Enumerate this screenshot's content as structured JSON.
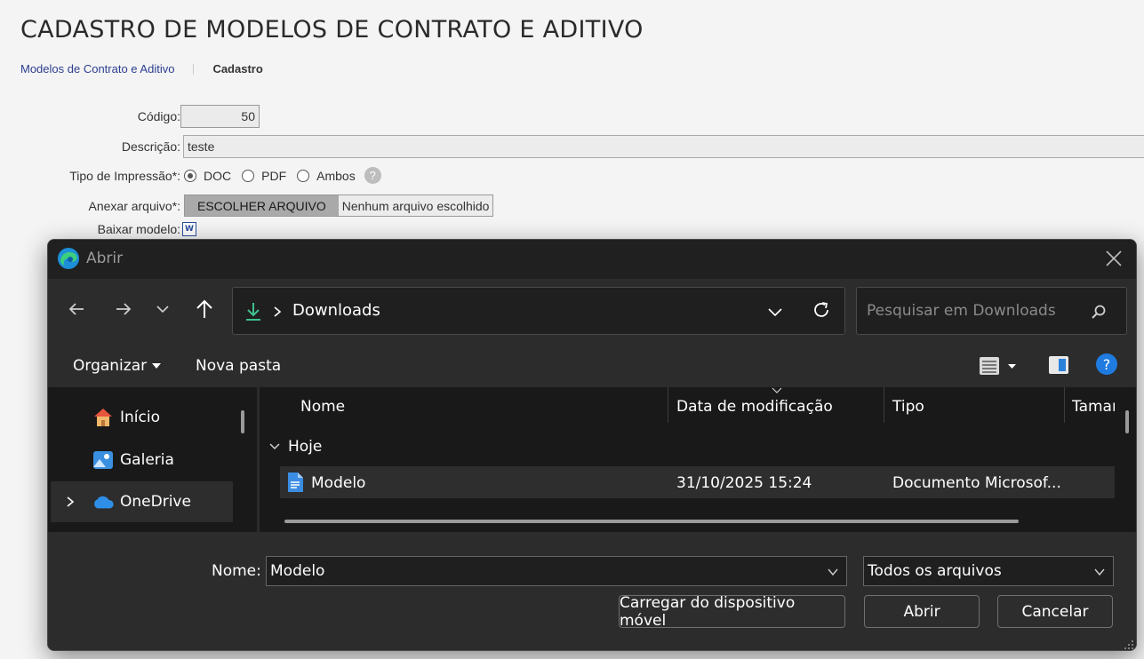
{
  "page": {
    "title": "CADASTRO DE MODELOS DE CONTRATO E ADITIVO",
    "breadcrumb": {
      "link": "Modelos de Contrato e Aditivo",
      "current": "Cadastro"
    },
    "form": {
      "codigo_label": "Código:",
      "codigo_value": "50",
      "descricao_label": "Descrição:",
      "descricao_value": "teste",
      "tipo_label": "Tipo de Impressão*:",
      "tipo_options": [
        "DOC",
        "PDF",
        "Ambos"
      ],
      "tipo_selected": "DOC",
      "help_glyph": "?",
      "anexar_label": "Anexar arquivo*:",
      "choose_file_button": "ESCOLHER ARQUIVO",
      "no_file_text": "Nenhum arquivo escolhido",
      "baixar_label": "Baixar modelo:",
      "word_glyph": "W"
    }
  },
  "dialog": {
    "title": "Abrir",
    "address": {
      "folder": "Downloads"
    },
    "search_placeholder": "Pesquisar em Downloads",
    "toolbar": {
      "organize": "Organizar",
      "new_folder": "Nova pasta",
      "help_glyph": "?"
    },
    "nav_items": [
      {
        "label": "Início",
        "icon": "home-icon"
      },
      {
        "label": "Galeria",
        "icon": "gallery-icon"
      },
      {
        "label": "OneDrive",
        "icon": "onedrive-icon"
      }
    ],
    "columns": [
      "Nome",
      "Data de modificação",
      "Tipo",
      "Tamar"
    ],
    "group": "Hoje",
    "files": [
      {
        "name": "Modelo",
        "modified": "31/10/2025 15:24",
        "type": "Documento Microsof..."
      }
    ],
    "footer": {
      "name_label": "Nome:",
      "name_value": "Modelo",
      "type_filter": "Todos os arquivos",
      "upload_button": "Carregar do dispositivo móvel",
      "open_button": "Abrir",
      "cancel_button": "Cancelar"
    }
  },
  "colors": {
    "accent": "#0a84ff",
    "dialog_bg": "#202020",
    "page_bg": "#f4f4f4",
    "link": "#2c3e8f"
  }
}
